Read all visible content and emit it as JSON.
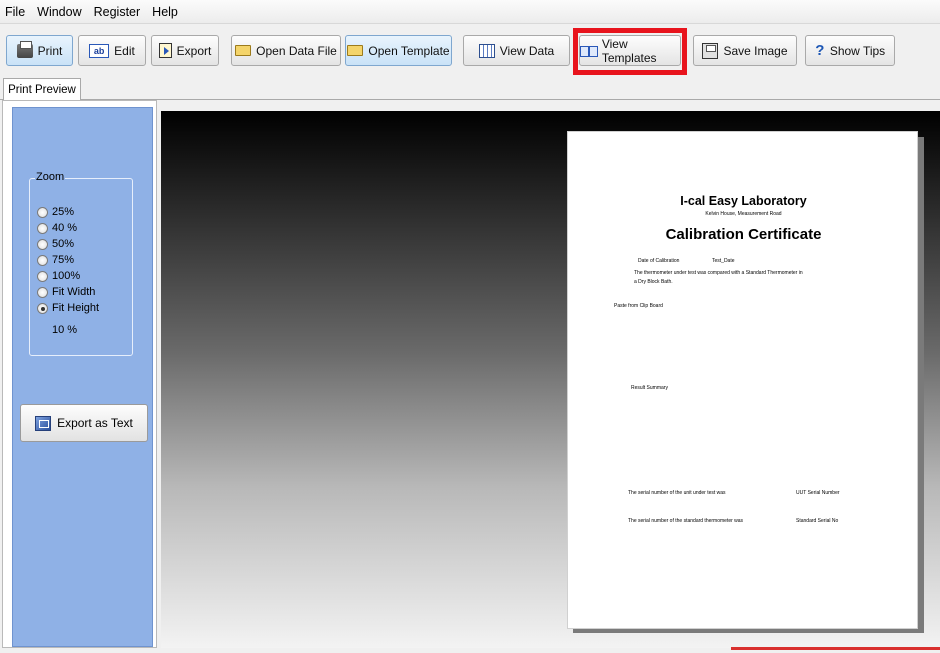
{
  "menu": {
    "file": "File",
    "window": "Window",
    "register": "Register",
    "help": "Help"
  },
  "toolbar": {
    "print": "Print",
    "edit": "Edit",
    "export": "Export",
    "open_data_file": "Open Data File",
    "open_template": "Open Template",
    "view_data": "View Data",
    "view_templates": "View Templates",
    "save_image": "Save Image",
    "show_tips": "Show Tips",
    "edit_icon_text": "ab"
  },
  "tabs": {
    "print_preview": "Print Preview"
  },
  "zoom": {
    "title": "Zoom",
    "options": [
      "25%",
      "40 %",
      "50%",
      "75%",
      "100%",
      "Fit Width",
      "Fit Height"
    ],
    "selected": "Fit Height",
    "current_value": "10 %"
  },
  "left_panel": {
    "export_as_text": "Export as Text"
  },
  "document": {
    "lab_name": "I-cal Easy Laboratory",
    "address": "Kelvin House, Measurement Road",
    "certificate_title": "Calibration Certificate",
    "date_label": "Date of Calibration",
    "date_value": "Test_Date",
    "intro_line1": "The thermometer under test was compared with a Standard Thermometer in",
    "intro_line2": "a Dry Block Bath.",
    "paste_note": "Paste from Clip Board",
    "result_summary": "Result Summary",
    "serial_unit_text": "The serial number of the unit under test was",
    "serial_unit_value": "UUT Serial Number",
    "serial_std_text": "The serial number of the standard thermometer was",
    "serial_std_value": "Standard Serial No"
  },
  "colors": {
    "highlight": "#e8141d",
    "left_panel_bg": "#8fb1e6"
  }
}
